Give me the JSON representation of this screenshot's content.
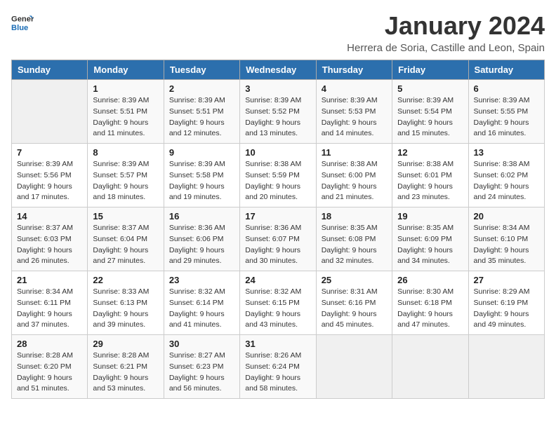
{
  "header": {
    "logo_line1": "General",
    "logo_line2": "Blue",
    "month_title": "January 2024",
    "subtitle": "Herrera de Soria, Castille and Leon, Spain"
  },
  "weekdays": [
    "Sunday",
    "Monday",
    "Tuesday",
    "Wednesday",
    "Thursday",
    "Friday",
    "Saturday"
  ],
  "weeks": [
    [
      {
        "day": "",
        "sunrise": "",
        "sunset": "",
        "daylight": ""
      },
      {
        "day": "1",
        "sunrise": "Sunrise: 8:39 AM",
        "sunset": "Sunset: 5:51 PM",
        "daylight": "Daylight: 9 hours and 11 minutes."
      },
      {
        "day": "2",
        "sunrise": "Sunrise: 8:39 AM",
        "sunset": "Sunset: 5:51 PM",
        "daylight": "Daylight: 9 hours and 12 minutes."
      },
      {
        "day": "3",
        "sunrise": "Sunrise: 8:39 AM",
        "sunset": "Sunset: 5:52 PM",
        "daylight": "Daylight: 9 hours and 13 minutes."
      },
      {
        "day": "4",
        "sunrise": "Sunrise: 8:39 AM",
        "sunset": "Sunset: 5:53 PM",
        "daylight": "Daylight: 9 hours and 14 minutes."
      },
      {
        "day": "5",
        "sunrise": "Sunrise: 8:39 AM",
        "sunset": "Sunset: 5:54 PM",
        "daylight": "Daylight: 9 hours and 15 minutes."
      },
      {
        "day": "6",
        "sunrise": "Sunrise: 8:39 AM",
        "sunset": "Sunset: 5:55 PM",
        "daylight": "Daylight: 9 hours and 16 minutes."
      }
    ],
    [
      {
        "day": "7",
        "sunrise": "Sunrise: 8:39 AM",
        "sunset": "Sunset: 5:56 PM",
        "daylight": "Daylight: 9 hours and 17 minutes."
      },
      {
        "day": "8",
        "sunrise": "Sunrise: 8:39 AM",
        "sunset": "Sunset: 5:57 PM",
        "daylight": "Daylight: 9 hours and 18 minutes."
      },
      {
        "day": "9",
        "sunrise": "Sunrise: 8:39 AM",
        "sunset": "Sunset: 5:58 PM",
        "daylight": "Daylight: 9 hours and 19 minutes."
      },
      {
        "day": "10",
        "sunrise": "Sunrise: 8:38 AM",
        "sunset": "Sunset: 5:59 PM",
        "daylight": "Daylight: 9 hours and 20 minutes."
      },
      {
        "day": "11",
        "sunrise": "Sunrise: 8:38 AM",
        "sunset": "Sunset: 6:00 PM",
        "daylight": "Daylight: 9 hours and 21 minutes."
      },
      {
        "day": "12",
        "sunrise": "Sunrise: 8:38 AM",
        "sunset": "Sunset: 6:01 PM",
        "daylight": "Daylight: 9 hours and 23 minutes."
      },
      {
        "day": "13",
        "sunrise": "Sunrise: 8:38 AM",
        "sunset": "Sunset: 6:02 PM",
        "daylight": "Daylight: 9 hours and 24 minutes."
      }
    ],
    [
      {
        "day": "14",
        "sunrise": "Sunrise: 8:37 AM",
        "sunset": "Sunset: 6:03 PM",
        "daylight": "Daylight: 9 hours and 26 minutes."
      },
      {
        "day": "15",
        "sunrise": "Sunrise: 8:37 AM",
        "sunset": "Sunset: 6:04 PM",
        "daylight": "Daylight: 9 hours and 27 minutes."
      },
      {
        "day": "16",
        "sunrise": "Sunrise: 8:36 AM",
        "sunset": "Sunset: 6:06 PM",
        "daylight": "Daylight: 9 hours and 29 minutes."
      },
      {
        "day": "17",
        "sunrise": "Sunrise: 8:36 AM",
        "sunset": "Sunset: 6:07 PM",
        "daylight": "Daylight: 9 hours and 30 minutes."
      },
      {
        "day": "18",
        "sunrise": "Sunrise: 8:35 AM",
        "sunset": "Sunset: 6:08 PM",
        "daylight": "Daylight: 9 hours and 32 minutes."
      },
      {
        "day": "19",
        "sunrise": "Sunrise: 8:35 AM",
        "sunset": "Sunset: 6:09 PM",
        "daylight": "Daylight: 9 hours and 34 minutes."
      },
      {
        "day": "20",
        "sunrise": "Sunrise: 8:34 AM",
        "sunset": "Sunset: 6:10 PM",
        "daylight": "Daylight: 9 hours and 35 minutes."
      }
    ],
    [
      {
        "day": "21",
        "sunrise": "Sunrise: 8:34 AM",
        "sunset": "Sunset: 6:11 PM",
        "daylight": "Daylight: 9 hours and 37 minutes."
      },
      {
        "day": "22",
        "sunrise": "Sunrise: 8:33 AM",
        "sunset": "Sunset: 6:13 PM",
        "daylight": "Daylight: 9 hours and 39 minutes."
      },
      {
        "day": "23",
        "sunrise": "Sunrise: 8:32 AM",
        "sunset": "Sunset: 6:14 PM",
        "daylight": "Daylight: 9 hours and 41 minutes."
      },
      {
        "day": "24",
        "sunrise": "Sunrise: 8:32 AM",
        "sunset": "Sunset: 6:15 PM",
        "daylight": "Daylight: 9 hours and 43 minutes."
      },
      {
        "day": "25",
        "sunrise": "Sunrise: 8:31 AM",
        "sunset": "Sunset: 6:16 PM",
        "daylight": "Daylight: 9 hours and 45 minutes."
      },
      {
        "day": "26",
        "sunrise": "Sunrise: 8:30 AM",
        "sunset": "Sunset: 6:18 PM",
        "daylight": "Daylight: 9 hours and 47 minutes."
      },
      {
        "day": "27",
        "sunrise": "Sunrise: 8:29 AM",
        "sunset": "Sunset: 6:19 PM",
        "daylight": "Daylight: 9 hours and 49 minutes."
      }
    ],
    [
      {
        "day": "28",
        "sunrise": "Sunrise: 8:28 AM",
        "sunset": "Sunset: 6:20 PM",
        "daylight": "Daylight: 9 hours and 51 minutes."
      },
      {
        "day": "29",
        "sunrise": "Sunrise: 8:28 AM",
        "sunset": "Sunset: 6:21 PM",
        "daylight": "Daylight: 9 hours and 53 minutes."
      },
      {
        "day": "30",
        "sunrise": "Sunrise: 8:27 AM",
        "sunset": "Sunset: 6:23 PM",
        "daylight": "Daylight: 9 hours and 56 minutes."
      },
      {
        "day": "31",
        "sunrise": "Sunrise: 8:26 AM",
        "sunset": "Sunset: 6:24 PM",
        "daylight": "Daylight: 9 hours and 58 minutes."
      },
      {
        "day": "",
        "sunrise": "",
        "sunset": "",
        "daylight": ""
      },
      {
        "day": "",
        "sunrise": "",
        "sunset": "",
        "daylight": ""
      },
      {
        "day": "",
        "sunrise": "",
        "sunset": "",
        "daylight": ""
      }
    ]
  ]
}
